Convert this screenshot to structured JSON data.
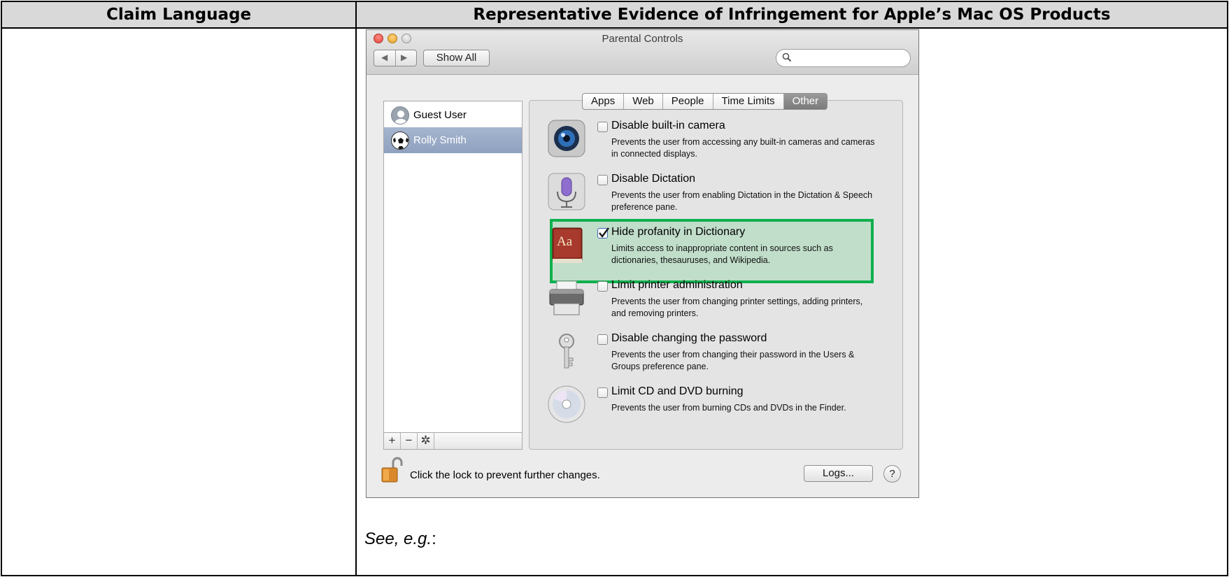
{
  "table": {
    "col_left_header": "Claim Language",
    "col_right_header": "Representative Evidence of Infringement for Apple’s Mac OS Products"
  },
  "window": {
    "title": "Parental Controls",
    "show_all": "Show All",
    "search_placeholder": "",
    "nav_back": "◀",
    "nav_forward": "▶"
  },
  "users": [
    {
      "name": "Guest User",
      "selected": false,
      "avatar": "user-silhouette-icon"
    },
    {
      "name": "Rolly Smith",
      "selected": true,
      "avatar": "soccer-ball-icon"
    }
  ],
  "list_toolbar": {
    "add": "+",
    "remove": "−",
    "settings": "✲"
  },
  "tabs": [
    {
      "label": "Apps",
      "active": false
    },
    {
      "label": "Web",
      "active": false
    },
    {
      "label": "People",
      "active": false
    },
    {
      "label": "Time Limits",
      "active": false
    },
    {
      "label": "Other",
      "active": true
    }
  ],
  "options": [
    {
      "label": "Disable built-in camera",
      "desc": "Prevents the user from accessing any built-in cameras and cameras in connected displays.",
      "checked": false,
      "icon": "camera-icon"
    },
    {
      "label": "Disable Dictation",
      "desc": "Prevents the user from enabling Dictation in the Dictation & Speech preference pane.",
      "checked": false,
      "icon": "microphone-icon"
    },
    {
      "label": "Hide profanity in Dictionary",
      "desc": "Limits access to inappropriate content in sources such as dictionaries, thesauruses, and Wikipedia.",
      "checked": true,
      "icon": "dictionary-icon"
    },
    {
      "label": "Limit printer administration",
      "desc": "Prevents the user from changing printer settings, adding printers, and removing printers.",
      "checked": false,
      "icon": "printer-icon"
    },
    {
      "label": "Disable changing the password",
      "desc": "Prevents the user from changing their password in the Users & Groups preference pane.",
      "checked": false,
      "icon": "key-icon"
    },
    {
      "label": "Limit CD and DVD burning",
      "desc": "Prevents the user from burning CDs and DVDs in the Finder.",
      "checked": false,
      "icon": "disc-icon"
    }
  ],
  "dictionary_icon_text": "Aa",
  "footer": {
    "lock_text": "Click the lock to prevent further changes.",
    "logs_button": "Logs...",
    "help_button": "?"
  },
  "see_eg": {
    "italic": "See, e.g.",
    "suffix": ":"
  },
  "colors": {
    "highlight_border": "#10b04e",
    "header_bg": "#d9d9d9",
    "selection": "#95a7c4"
  }
}
